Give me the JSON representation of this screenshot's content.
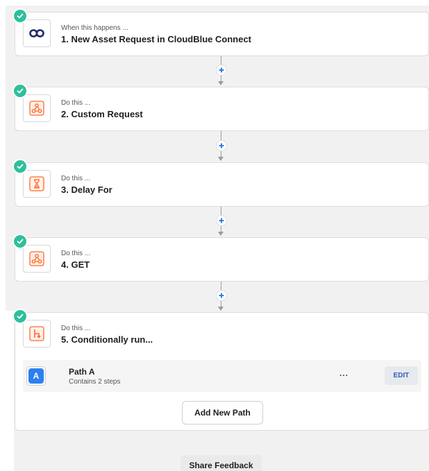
{
  "steps": [
    {
      "sub": "When this happens ...",
      "title": "1. New Asset Request in CloudBlue Connect",
      "icon": "cloudblue-logo-icon"
    },
    {
      "sub": "Do this ...",
      "title": "2. Custom Request",
      "icon": "webhook-icon"
    },
    {
      "sub": "Do this ...",
      "title": "3. Delay For",
      "icon": "hourglass-icon"
    },
    {
      "sub": "Do this ...",
      "title": "4. GET",
      "icon": "webhook-icon"
    },
    {
      "sub": "Do this ...",
      "title": "5. Conditionally run...",
      "icon": "paths-icon"
    }
  ],
  "paths": [
    {
      "badge": "A",
      "name": "Path A",
      "steps": "Contains 2 steps",
      "more": "...",
      "edit": "EDIT"
    }
  ],
  "add_path_label": "Add New Path",
  "feedback_label": "Share Feedback",
  "colors": {
    "check": "#2fbf9c",
    "accent_orange": "#ff6a2b",
    "plus_blue": "#2d7ff0",
    "cloudblue_navy": "#1b2a6b",
    "edit_text": "#3460b5"
  }
}
